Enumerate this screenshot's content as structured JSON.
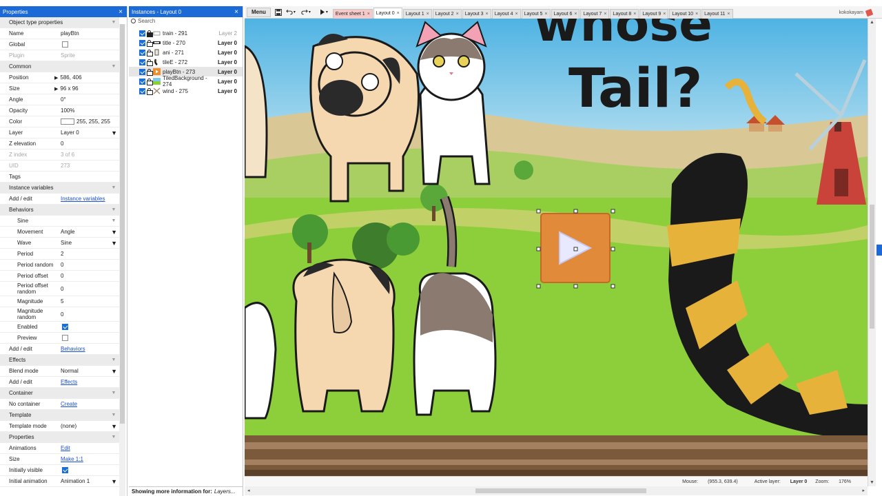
{
  "properties": {
    "title": "Properties",
    "rows": [
      {
        "type": "section",
        "label": "Object type properties"
      },
      {
        "label": "Name",
        "value": "playBtn"
      },
      {
        "label": "Global",
        "kind": "checkbox",
        "checked": false
      },
      {
        "label": "Plugin",
        "value": "Sprite",
        "disabled": true
      },
      {
        "type": "section",
        "label": "Common"
      },
      {
        "label": "Position",
        "value": "586, 406",
        "expand": true
      },
      {
        "label": "Size",
        "value": "96 x 96",
        "expand": true
      },
      {
        "label": "Angle",
        "value": "0°"
      },
      {
        "label": "Opacity",
        "value": "100%"
      },
      {
        "label": "Color",
        "value": "255, 255, 255",
        "kind": "color"
      },
      {
        "label": "Layer",
        "value": "Layer 0",
        "kind": "dropdown"
      },
      {
        "label": "Z elevation",
        "value": "0"
      },
      {
        "label": "Z index",
        "value": "3 of 6",
        "disabled": true
      },
      {
        "label": "UID",
        "value": "273",
        "disabled": true
      },
      {
        "label": "Tags",
        "value": ""
      },
      {
        "type": "section",
        "label": "Instance variables"
      },
      {
        "label": "Add / edit",
        "value": "Instance variables",
        "kind": "link"
      },
      {
        "type": "section",
        "label": "Behaviors"
      },
      {
        "type": "subsection",
        "label": "Sine"
      },
      {
        "label": "Movement",
        "value": "Angle",
        "kind": "dropdown",
        "indent": true
      },
      {
        "label": "Wave",
        "value": "Sine",
        "kind": "dropdown",
        "indent": true
      },
      {
        "label": "Period",
        "value": "2",
        "indent": true
      },
      {
        "label": "Period random",
        "value": "0",
        "indent": true
      },
      {
        "label": "Period offset",
        "value": "0",
        "indent": true
      },
      {
        "label": "Period offset random",
        "value": "0",
        "indent": true,
        "tall": true
      },
      {
        "label": "Magnitude",
        "value": "5",
        "indent": true
      },
      {
        "label": "Magnitude random",
        "value": "0",
        "indent": true,
        "tall": true
      },
      {
        "label": "Enabled",
        "kind": "checkbox",
        "checked": true,
        "indent": true
      },
      {
        "label": "Preview",
        "kind": "checkbox",
        "checked": false,
        "indent": true
      },
      {
        "label": "Add / edit",
        "value": "Behaviors",
        "kind": "link"
      },
      {
        "type": "section",
        "label": "Effects"
      },
      {
        "label": "Blend mode",
        "value": "Normal",
        "kind": "dropdown"
      },
      {
        "label": "Add / edit",
        "value": "Effects",
        "kind": "link"
      },
      {
        "type": "section",
        "label": "Container"
      },
      {
        "label": "No container",
        "value": "Create",
        "kind": "link"
      },
      {
        "type": "section",
        "label": "Template"
      },
      {
        "label": "Template mode",
        "value": "(none)",
        "kind": "dropdown"
      },
      {
        "type": "section",
        "label": "Properties"
      },
      {
        "label": "Animations",
        "value": "Edit",
        "kind": "link"
      },
      {
        "label": "Size",
        "value": "Make 1:1",
        "kind": "link"
      },
      {
        "label": "Initially visible",
        "kind": "checkbox",
        "checked": true
      },
      {
        "label": "Initial animation",
        "value": "Animation 1",
        "kind": "dropdown"
      }
    ]
  },
  "instances": {
    "title": "Instances - Layout 0",
    "search_placeholder": "Search",
    "items": [
      {
        "name": "train - 291",
        "layer": "Layer 2",
        "dim": true,
        "lock": "solid",
        "icon": "train-icon"
      },
      {
        "name": "title - 270",
        "layer": "Layer 0",
        "lock": "open",
        "icon": "title-text-icon"
      },
      {
        "name": "ani - 271",
        "layer": "Layer 0",
        "lock": "open",
        "icon": "ani-sprite-icon"
      },
      {
        "name": "tileE - 272",
        "layer": "Layer 0",
        "lock": "open",
        "icon": "tail-sprite-icon"
      },
      {
        "name": "playBtn - 273",
        "layer": "Layer 0",
        "lock": "open",
        "icon": "play-button-icon",
        "selected": true
      },
      {
        "name": "TiledBackground - 274",
        "layer": "Layer 0",
        "lock": "open",
        "icon": "tiled-background-icon"
      },
      {
        "name": "wind - 275",
        "layer": "Layer 0",
        "lock": "open",
        "icon": "wind-icon"
      }
    ],
    "footer_label": "Showing more information for:",
    "footer_value": "Layers..."
  },
  "toolbar": {
    "menu_label": "Menu",
    "tabs": [
      {
        "label": "Event sheet 1",
        "kind": "event"
      },
      {
        "label": "Layout 0",
        "kind": "active"
      },
      {
        "label": "Layout 1"
      },
      {
        "label": "Layout 2"
      },
      {
        "label": "Layout 3"
      },
      {
        "label": "Layout 4"
      },
      {
        "label": "Layout 5"
      },
      {
        "label": "Layout 6"
      },
      {
        "label": "Layout 7"
      },
      {
        "label": "Layout 8"
      },
      {
        "label": "Layout 9"
      },
      {
        "label": "Layout 10"
      },
      {
        "label": "Layout 11"
      }
    ],
    "tab_close_glyph": "×",
    "username": "kokokayam"
  },
  "canvas": {
    "title_line1": "whose",
    "title_line2": "Tail?"
  },
  "status": {
    "mouse_label": "Mouse:",
    "mouse_value": "(955.3, 639.4)",
    "active_layer_label": "Active layer:",
    "active_layer_value": "Layer 0",
    "zoom_label": "Zoom:",
    "zoom_value": "176%"
  },
  "colors": {
    "accent": "#1c6ad6",
    "grass": "#8dcf3a",
    "play_button": "#e08a3a",
    "tail_black": "#1a1a1a",
    "tail_yellow": "#e6b23a"
  }
}
